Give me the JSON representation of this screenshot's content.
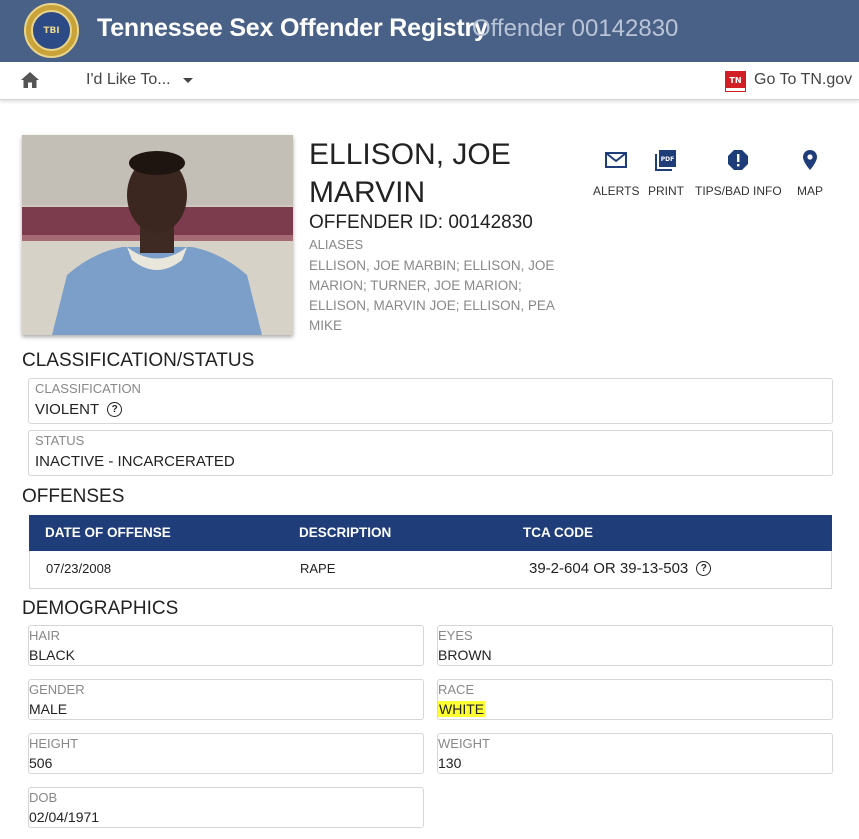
{
  "header": {
    "seal_text": "TBI",
    "title": "Tennessee Sex Offender Registry",
    "subtitle": "Offender 00142830"
  },
  "nav": {
    "menu_label": "I'd Like To...",
    "tn_logo_text": "TN",
    "tn_link": "Go To TN.gov"
  },
  "offender": {
    "name": "ELLISON, JOE MARVIN",
    "offender_id": "OFFENDER ID: 00142830",
    "aliases_label": "ALIASES",
    "aliases": "ELLISON, JOE MARBIN; ELLISON, JOE MARION; TURNER, JOE MARION; ELLISON, MARVIN JOE; ELLISON, PEA MIKE"
  },
  "actions": {
    "alerts": "ALERTS",
    "print": "PRINT",
    "tips": "TIPS/BAD INFO",
    "map": "MAP"
  },
  "classification_status": {
    "title": "CLASSIFICATION/STATUS",
    "classification_label": "CLASSIFICATION",
    "classification_value": "VIOLENT",
    "status_label": "STATUS",
    "status_value": "INACTIVE - INCARCERATED"
  },
  "offenses": {
    "title": "OFFENSES",
    "headers": [
      "DATE OF OFFENSE",
      "DESCRIPTION",
      "TCA CODE"
    ],
    "rows": [
      {
        "date": "07/23/2008",
        "description": "RAPE",
        "tca_code": "39-2-604 OR 39-13-503"
      }
    ]
  },
  "demographics": {
    "title": "DEMOGRAPHICS",
    "hair_label": "HAIR",
    "hair": "BLACK",
    "eyes_label": "EYES",
    "eyes": "BROWN",
    "gender_label": "GENDER",
    "gender": "MALE",
    "race_label": "RACE",
    "race": "WHITE",
    "height_label": "HEIGHT",
    "height": "506",
    "weight_label": "WEIGHT",
    "weight": "130",
    "dob_label": "DOB",
    "dob": "02/04/1971"
  },
  "colors": {
    "header_bg": "#4a6187",
    "table_header_bg": "#1f3d79",
    "highlight": "#ffff33"
  },
  "icons": {
    "home": "home-icon",
    "alerts": "envelope-icon",
    "print": "pdf-icon",
    "tips": "exclamation-circle-icon",
    "map": "map-pin-icon",
    "help": "question-circle-icon"
  }
}
